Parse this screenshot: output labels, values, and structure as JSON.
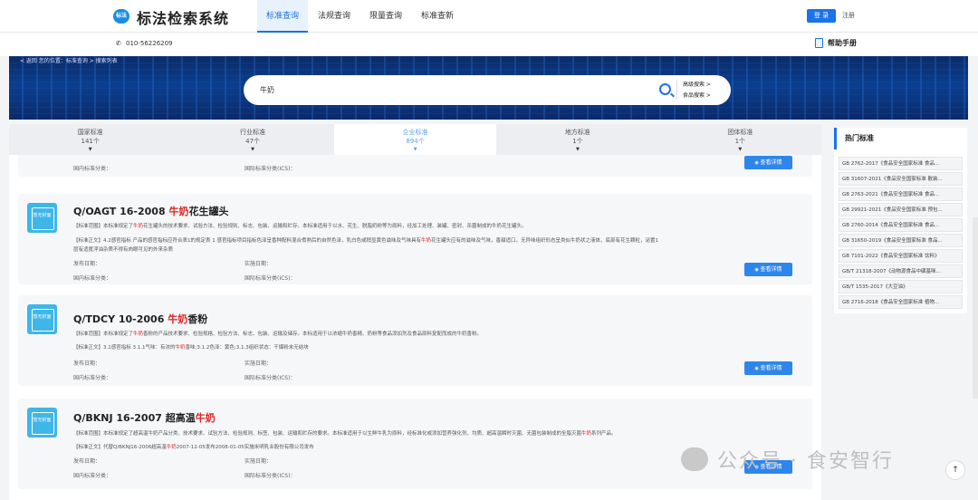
{
  "header": {
    "logo_badge": "标法",
    "logo_text": "标法检索系统",
    "nav": [
      "标准查询",
      "法规查询",
      "限量查询",
      "标准查新"
    ],
    "login": "登 录",
    "register": "注册"
  },
  "subbar": {
    "phone": "010-56226209",
    "manual": "帮助手册"
  },
  "banner": {
    "crumb": "< 返回     您的位置：标准查询 > 搜索列表"
  },
  "search": {
    "value": "牛奶",
    "advanced": "高级搜索 >",
    "food": "食品搜索 >"
  },
  "tabs": [
    {
      "label": "国家标准",
      "count": "141个"
    },
    {
      "label": "行业标准",
      "count": "47个"
    },
    {
      "label": "企业标准",
      "count": "894个"
    },
    {
      "label": "地方标准",
      "count": "1个"
    },
    {
      "label": "团体标准",
      "count": "1个"
    }
  ],
  "book_label": "暂无封面",
  "labels": {
    "publish": "发布日期：",
    "implement": "实施日期：",
    "domestic": "国内标准分类：",
    "ics": "国际标准分类(ICS)：",
    "detail": "查看详情"
  },
  "cards": [
    {
      "code": "Q/OAGT 16-2008",
      "title_hl": "牛奶",
      "title_rest": "花生罐头",
      "scope_a": "【标准范围】本标准规定了",
      "scope_hl": "牛奶",
      "scope_b": "花生罐头的技术要求、试验方法、检验规则、标志、包装、运输和贮存。本标准适用于以水、花生、脱脂奶粉等为原料，经加工处理、装罐、密封、杀菌制成的牛奶花生罐头。",
      "text_a": "【标准正文】4.2感官指标 产品的感官指标应符合表1的规定表 1 感官指标项目指标色泽呈香种配料混合煮熟后的自然色泽，乳白色或稍显黄色滋味及气味具有",
      "text_hl": "牛奶",
      "text_b": "花生罐头应有的滋味及气味，香甜适口，无异味组织形态呈类似牛奶状之液体，底部有花生颗粒，泌置1",
      "text_c": "层有适度浮油杂质不得有肉眼可见的外来杂质"
    },
    {
      "code": "Q/TDCY 10-2006",
      "title_hl": "牛奶",
      "title_rest": "香粉",
      "scope_a": "【标准范围】本标准规定了",
      "scope_hl": "牛奶",
      "scope_b": "香粉的产品技术要求、检验规格、检验方法、标志、包装、运输及储存。本标适用于以浓缩牛奶香精、奶粉等食品添加剂及食品原料复配而成的牛奶香粉。",
      "text_a": "【标准正文】3.1感官指标 3.1.1气味：有浓的",
      "text_hl": "牛奶",
      "text_b": "香味;3.1.2色泽：黄色;3.1.3组织状态：干爆粉末无结块",
      "text_c": ""
    },
    {
      "code": "Q/BKNJ 16-2007",
      "title_hl": "超高温",
      "title_rest": "牛奶",
      "scope_a": "【标准范围】本标准规定了超高温牛奶产品分类、技术要求、试验方法、检验规则、标签、包装、运输和贮存的要求。本标准适用于以生鲜牛乳为原料，经标准化或添加营养强化剂、均质、超高温瞬时灭菌、无菌包装制成的全脂灭菌",
      "scope_hl": "牛奶",
      "scope_b": "系列产品。",
      "text_a": "【标准正文】代替Q/BKNJ16-2006超高温",
      "text_hl": "牛奶",
      "text_b": "2007-12-05发布2008-01-05实施米明乳业股份有限公司发布",
      "text_c": ""
    }
  ],
  "hot": {
    "title": "热门标准",
    "items": [
      "GB 2762-2017《食品安全国家标准 食品...",
      "GB 31607-2021《食品安全国家标准 散装...",
      "GB 2763-2021《食品安全国家标准 食品...",
      "GB 29921-2021《食品安全国家标准 预包...",
      "GB 2760-2014《食品安全国家标准 食品...",
      "GB 31650-2019《食品安全国家标准 食品...",
      "GB 7101-2022《食品安全国家标准 饮料》",
      "GB/T 21318-2007《动物源食品中磺基咪...",
      "GB/T 1535-2017《大豆油》",
      "GB 2716-2018《食品安全国家标准 植物..."
    ]
  },
  "watermark": "公众号 · 食安智行",
  "totop": "↑"
}
